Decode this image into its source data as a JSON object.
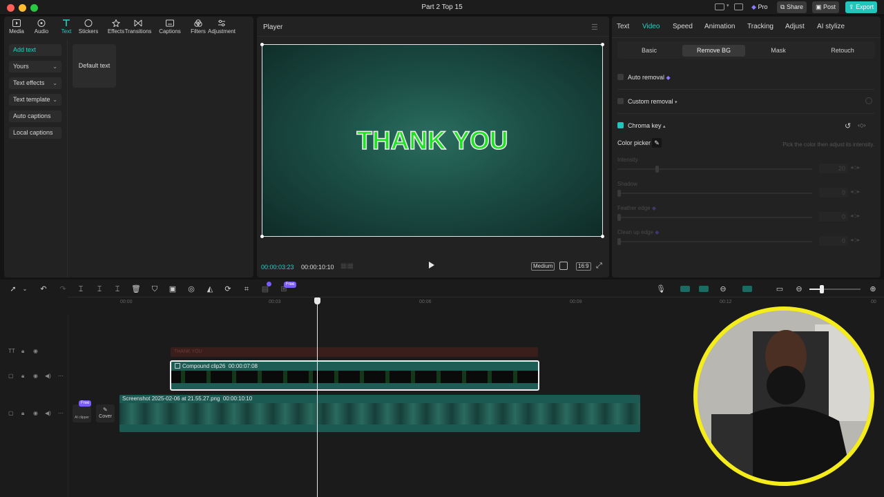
{
  "window": {
    "title": "Part 2 Top 15"
  },
  "titlebar_actions": {
    "pro": "Pro",
    "share": "Share",
    "post": "Post",
    "export": "Export"
  },
  "toolbar": [
    {
      "label": "Media",
      "icon": "media-icon"
    },
    {
      "label": "Audio",
      "icon": "audio-icon"
    },
    {
      "label": "Text",
      "icon": "text-icon",
      "active": true
    },
    {
      "label": "Stickers",
      "icon": "stickers-icon"
    },
    {
      "label": "Effects",
      "icon": "effects-icon"
    },
    {
      "label": "Transitions",
      "icon": "transitions-icon"
    },
    {
      "label": "Captions",
      "icon": "captions-icon"
    },
    {
      "label": "Filters",
      "icon": "filters-icon"
    },
    {
      "label": "Adjustment",
      "icon": "adjustment-icon"
    }
  ],
  "left_nav": {
    "items": [
      "Add text",
      "Yours",
      "Text effects",
      "Text template",
      "Auto captions",
      "Local captions"
    ],
    "default_text_card": "Default text"
  },
  "player": {
    "title": "Player",
    "preview_text": "THANK YOU",
    "current_time": "00:00:03:23",
    "total_time": "00:00:10:10",
    "quality": "Medium",
    "ratio": "16:9"
  },
  "inspector": {
    "tabs": [
      "Text",
      "Video",
      "Speed",
      "Animation",
      "Tracking",
      "Adjust",
      "AI stylize"
    ],
    "active_tab": "Video",
    "subtabs": [
      "Basic",
      "Remove BG",
      "Mask",
      "Retouch"
    ],
    "active_subtab": "Remove BG",
    "auto_removal": "Auto removal",
    "custom_removal": "Custom removal",
    "chroma_key": "Chroma key",
    "color_picker": "Color picker",
    "color_picker_hint": "Pick the color then adjust its intensity.",
    "sliders": [
      {
        "label": "Intensity",
        "value": "20",
        "level": 0.2
      },
      {
        "label": "Shadow",
        "value": "0",
        "level": 0
      },
      {
        "label": "Feather edge",
        "value": "0",
        "level": 0
      },
      {
        "label": "Clean up edge",
        "value": "0",
        "level": 0
      }
    ]
  },
  "timeline": {
    "ruler": [
      "00:00",
      "00:03",
      "00:06",
      "00:09",
      "00:12",
      "00"
    ],
    "text_clip": "THANK YOU",
    "compound_clip": {
      "name": "Compound clip26",
      "duration": "00:00:07:08"
    },
    "main_clip": {
      "name": "Screenshot 2025-02-06 at 21.55.27.png",
      "duration": "00:00:10:10"
    },
    "free_badge": "Free",
    "ai_clipper": "AI clipper",
    "cover": "Cover"
  },
  "colors": {
    "accent": "#20d3c7",
    "clip_teal": "#1e5e57",
    "text_green": "#19e01c",
    "webcam_ring": "#f5ec1c"
  }
}
